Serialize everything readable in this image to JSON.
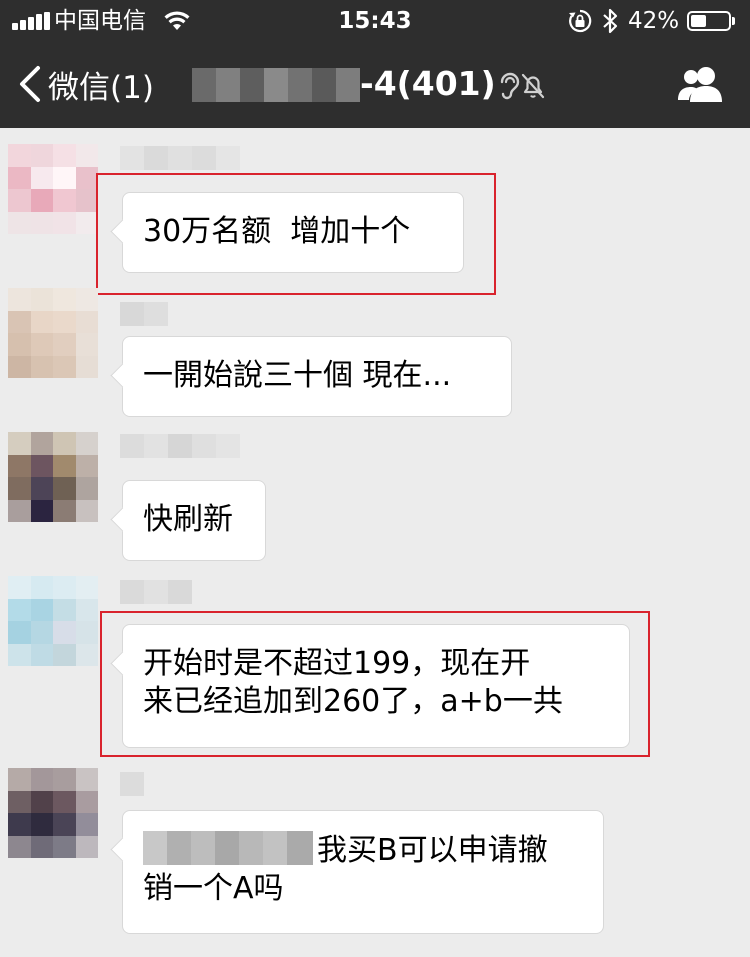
{
  "status_bar": {
    "carrier": "中国电信",
    "time": "15:43",
    "battery_percent": "42%",
    "battery_level": 0.42
  },
  "nav": {
    "back_label": "微信(1)",
    "title_visible": "-4(401)",
    "title_text_color": "#ffffff",
    "background": "#2e2e2e",
    "icons": [
      "chevron-left-icon",
      "earpiece-icon",
      "mute-icon",
      "group-members-icon"
    ]
  },
  "messages": [
    {
      "text": "30万名额  增加十个",
      "highlighted": true,
      "avatar_colors": [
        "#f2d6dc",
        "#efd6dc",
        "#f5e0e5",
        "#f2e8ea",
        "#ebb8c4",
        "#f7e9ee",
        "#fff6f8",
        "#e9c1cb",
        "#edc7d0",
        "#e8a9b9",
        "#f0c7d1",
        "#e6c2cb",
        "#eee4e6",
        "#efe3e6",
        "#f1e3e7",
        "#f2ebed"
      ]
    },
    {
      "text": "一開始說三十個 現在...",
      "highlighted": false,
      "avatar_colors": [
        "#ede5dd",
        "#ebe3d9",
        "#efe7de",
        "#eee8e3",
        "#d9c4b4",
        "#e8d6c7",
        "#ead9cb",
        "#e8ddd4",
        "#d6c0ae",
        "#dec9b8",
        "#e1cebf",
        "#e8dfd7",
        "#cdb6a4",
        "#d7c2b0",
        "#dbc7b6",
        "#e6ddd5"
      ]
    },
    {
      "text": "快刷新",
      "highlighted": false,
      "avatar_colors": [
        "#d5cdbf",
        "#b1a49d",
        "#cfc5b4",
        "#d6d1cd",
        "#8e7766",
        "#6d5560",
        "#a18a6d",
        "#bdb0a8",
        "#7f6c5f",
        "#4d4457",
        "#6f6154",
        "#aea49f",
        "#a99e9d",
        "#2b2440",
        "#8b7c74",
        "#c8c1bf"
      ]
    },
    {
      "text": "开始时是不超过199，现在开\n来已经追加到260了，a+b一共",
      "highlighted": true,
      "avatar_colors": [
        "#e0eef3",
        "#d6eaf1",
        "#dcecf2",
        "#e3eef2",
        "#b3dbe8",
        "#a9d4e3",
        "#c4dde5",
        "#d8e6eb",
        "#a5d2e1",
        "#b5d7e3",
        "#d7dde8",
        "#d6e3e8",
        "#cde3ea",
        "#bfdbe5",
        "#c3d6dc",
        "#dce6ea"
      ]
    },
    {
      "text": "我买B可以申请撤\n销一个A吗",
      "highlighted": false,
      "has_blurred_prefix": true,
      "avatar_colors": [
        "#b5aaa7",
        "#a3979a",
        "#a89d9e",
        "#c9c3c3",
        "#6e5f63",
        "#51414a",
        "#6c5860",
        "#a99ca0",
        "#3e3a4d",
        "#2f2b3e",
        "#4a4456",
        "#928d9a",
        "#8d878f",
        "#6f6b78",
        "#7d7b87",
        "#bdb8bd"
      ]
    }
  ],
  "colors": {
    "chat_background": "#ececec",
    "bubble_background": "#ffffff",
    "highlight_border": "#d9232d",
    "text": "#000000"
  }
}
